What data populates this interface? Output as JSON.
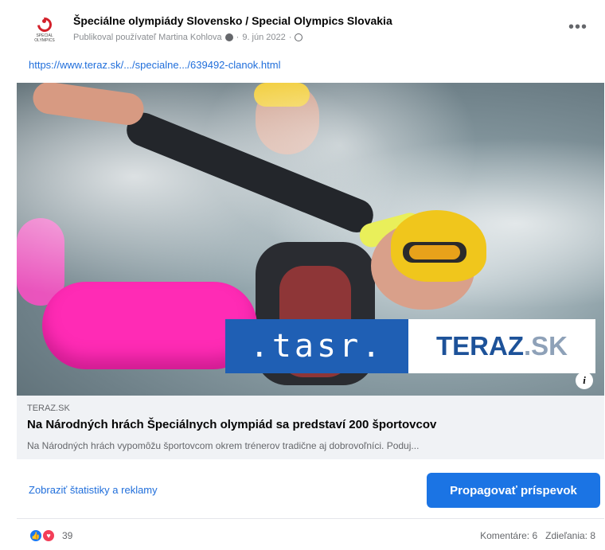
{
  "post": {
    "page_name": "Špeciálne olympiády Slovensko / Special Olympics Slovakia",
    "avatar_text": "SPECIAL OLYMPICS",
    "published_by": "Publikoval používateľ Martina Kohlova",
    "date": "9. jún 2022",
    "more_icon": "more-dots-icon",
    "link_url": "https://www.teraz.sk/.../specialne.../639492-clanok.html"
  },
  "image": {
    "logo_left": ".tasr.",
    "logo_right_a": "TERAZ",
    "logo_right_b": ".SK",
    "info_label": "i",
    "colors": {
      "tasr_blue": "#1f5fb4",
      "buoy_pink": "#ff2bb5",
      "cap_yellow": "#f0c61c"
    }
  },
  "preview": {
    "source": "TERAZ.SK",
    "title": "Na Národných hrách Špeciálnych olympiád sa predstaví 200 športovcov",
    "description": "Na Národných hrách vypomôžu športovcom okrem trénerov tradične aj dobrovoľníci. Poduj..."
  },
  "actions": {
    "stats_link": "Zobraziť štatistiky a reklamy",
    "boost_button": "Propagovať príspevok",
    "accent": "#1b74e4"
  },
  "engagement": {
    "reaction_count": "39",
    "comments": "Komentáre: 6",
    "shares": "Zdieľania: 8"
  }
}
